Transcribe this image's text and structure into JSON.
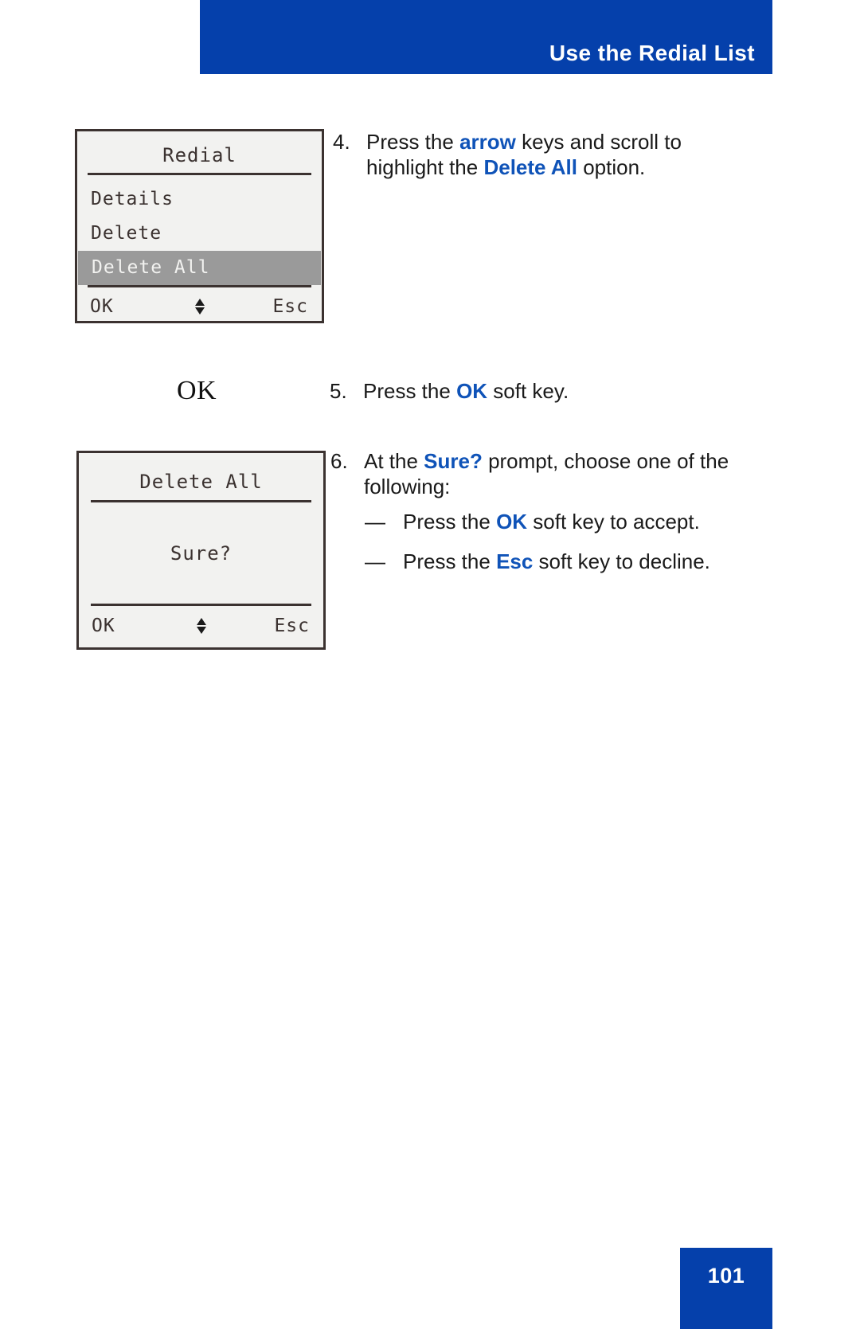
{
  "header": {
    "title": "Use the Redial List",
    "bg_color": "#0540ab",
    "text_color": "#ffffff"
  },
  "accent_color": "#0f53b8",
  "screens": [
    {
      "id": "redial-menu",
      "title": "Redial",
      "menu": [
        {
          "label": "Details",
          "selected": false
        },
        {
          "label": "Delete",
          "selected": false
        },
        {
          "label": "Delete All",
          "selected": true
        }
      ],
      "softkeys": {
        "left": "OK",
        "middle_icon": "up-down-arrow-icon",
        "right": "Esc"
      }
    },
    {
      "id": "delete-all-confirm",
      "title": "Delete All",
      "prompt": "Sure?",
      "softkeys": {
        "left": "OK",
        "middle_icon": "up-down-arrow-icon",
        "right": "Esc"
      }
    }
  ],
  "key_glyph": {
    "label": "OK"
  },
  "steps": [
    {
      "number": "4.",
      "parts": [
        {
          "text": "Press the ",
          "emphasis": false
        },
        {
          "text": "arrow",
          "emphasis": true
        },
        {
          "text": " keys and scroll to highlight the ",
          "emphasis": false
        },
        {
          "text": "Delete All",
          "emphasis": true
        },
        {
          "text": " option.",
          "emphasis": false
        }
      ]
    },
    {
      "number": "5.",
      "parts": [
        {
          "text": "Press the ",
          "emphasis": false
        },
        {
          "text": "OK",
          "emphasis": true
        },
        {
          "text": " soft key.",
          "emphasis": false
        }
      ]
    },
    {
      "number": "6.",
      "parts": [
        {
          "text": "At the ",
          "emphasis": false
        },
        {
          "text": "Sure?",
          "emphasis": true
        },
        {
          "text": " prompt, choose one of the following:",
          "emphasis": false
        }
      ]
    }
  ],
  "sub_items": [
    {
      "dash": "—",
      "parts": [
        {
          "text": "Press the ",
          "emphasis": false
        },
        {
          "text": "OK",
          "emphasis": true
        },
        {
          "text": " soft key to accept.",
          "emphasis": false
        }
      ]
    },
    {
      "dash": "—",
      "parts": [
        {
          "text": "Press the ",
          "emphasis": false
        },
        {
          "text": "Esc",
          "emphasis": true
        },
        {
          "text": " soft key to decline.",
          "emphasis": false
        }
      ]
    }
  ],
  "footer": {
    "page_number": "101",
    "bg_color": "#0540ab"
  }
}
